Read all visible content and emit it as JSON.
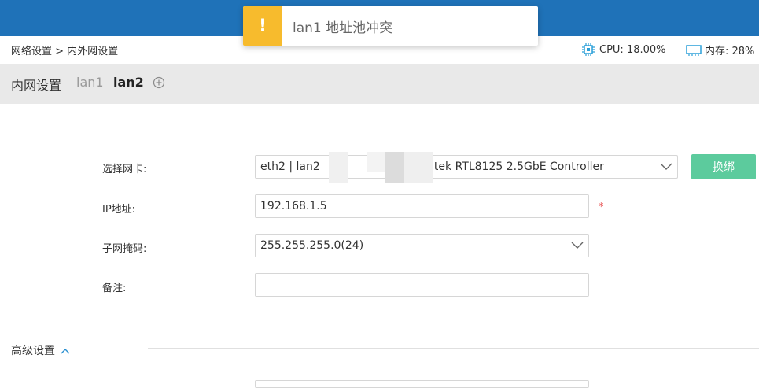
{
  "toast": {
    "icon": "exclamation-icon",
    "icon_glyph": "!",
    "message": "lan1 地址池冲突",
    "accent": "#f7bb2d"
  },
  "header": {
    "breadcrumb": "网络设置 > 内外网设置",
    "cpu_label": "CPU: 18.00%",
    "mem_label": "内存: 28%"
  },
  "tabs": {
    "title": "内网设置",
    "items": [
      {
        "label": "lan1",
        "active": false
      },
      {
        "label": "lan2",
        "active": true
      }
    ]
  },
  "form": {
    "nic": {
      "label": "选择网卡:",
      "value_prefix": "eth2 | lan2",
      "value_suffix": "Realtek RTL8125 2.5GbE Controller",
      "button": "换绑"
    },
    "ip": {
      "label": "IP地址:",
      "value": "192.168.1.5",
      "required": "*"
    },
    "mask": {
      "label": "子网掩码:",
      "value": "255.255.255.0(24)"
    },
    "note": {
      "label": "备注:",
      "value": ""
    }
  },
  "advanced": {
    "label": "高级设置"
  },
  "colors": {
    "topbar": "#1f72b8",
    "tabbar": "#e9e9e9",
    "button": "#5ccb9d",
    "required": "#e64c4c"
  }
}
